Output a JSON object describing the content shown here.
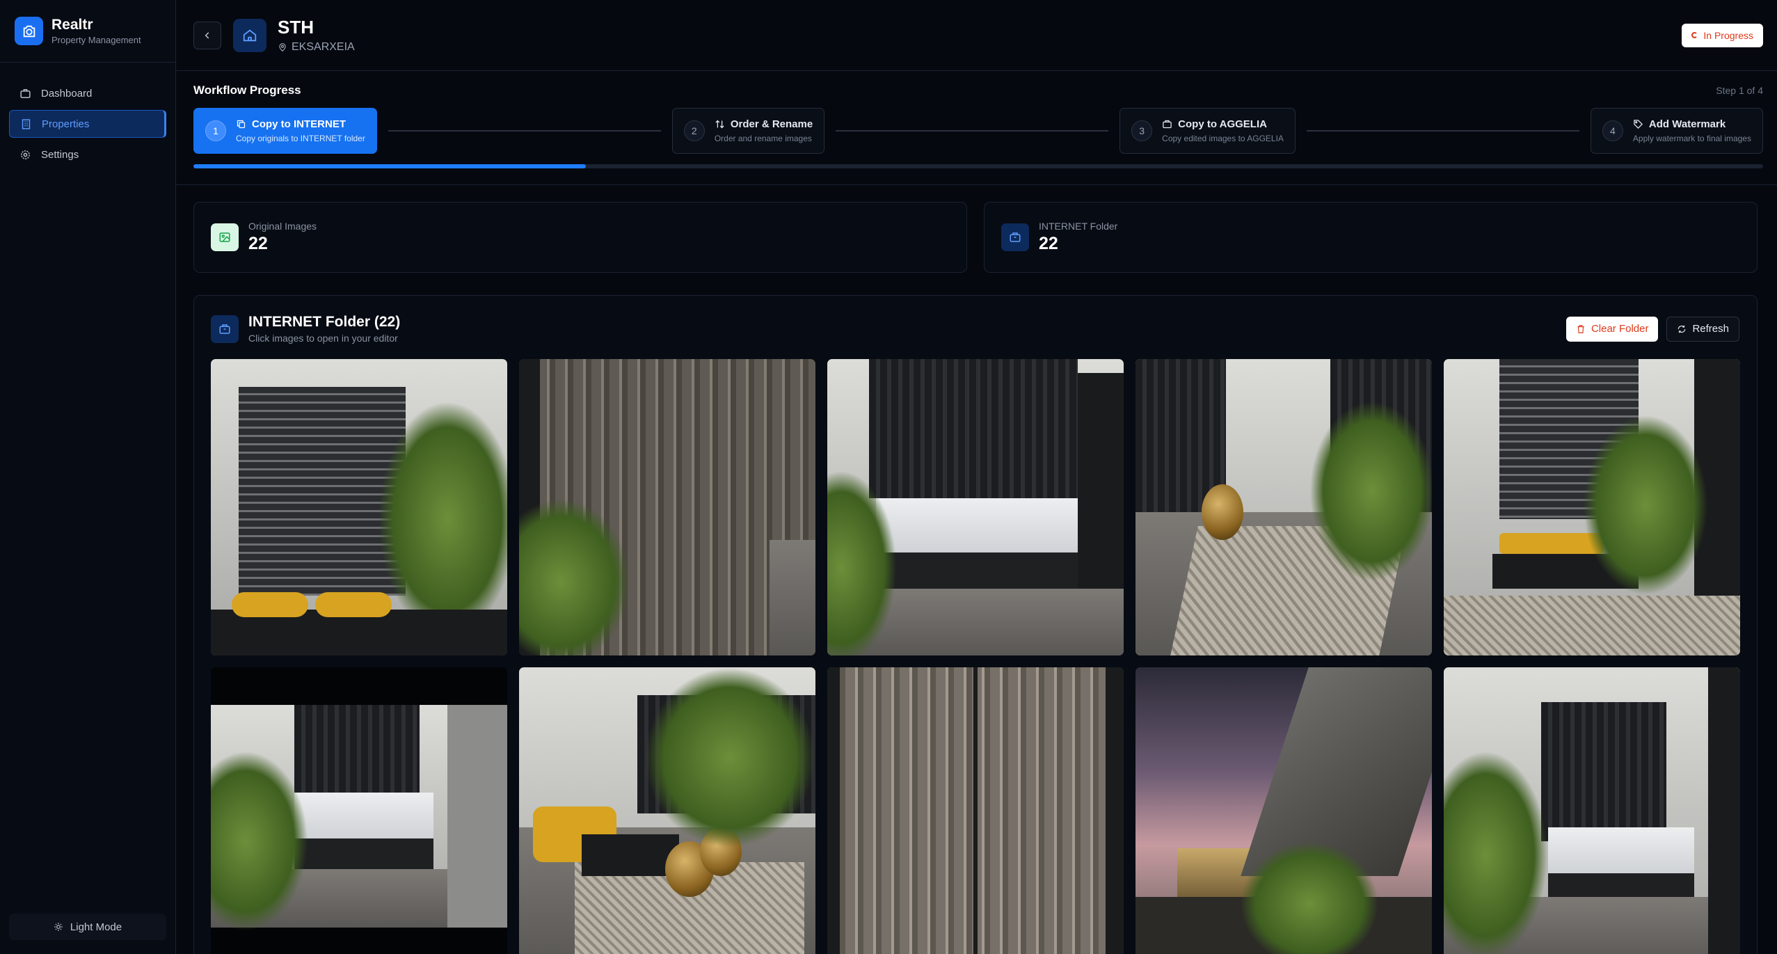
{
  "brand": {
    "name": "Realtr",
    "subtitle": "Property Management",
    "logo_icon": "camera-icon",
    "accent": "#1a6ff0"
  },
  "sidebar": {
    "items": [
      {
        "label": "Dashboard",
        "icon": "briefcase-icon",
        "active": false
      },
      {
        "label": "Properties",
        "icon": "building-icon",
        "active": true
      },
      {
        "label": "Settings",
        "icon": "gear-icon",
        "active": false
      }
    ],
    "light_mode_label": "Light Mode"
  },
  "header": {
    "title": "STH",
    "location": "EKSARXEIA",
    "status": "In Progress",
    "status_color": "#e0381b"
  },
  "workflow": {
    "title": "Workflow Progress",
    "step_indicator": "Step 1 of 4",
    "progress_fraction": 0.25,
    "steps": [
      {
        "num": "1",
        "label": "Copy to INTERNET",
        "desc": "Copy originals to INTERNET folder",
        "icon": "copy-icon",
        "active": true
      },
      {
        "num": "2",
        "label": "Order & Rename",
        "desc": "Order and rename images",
        "icon": "sort-arrows-icon",
        "active": false
      },
      {
        "num": "3",
        "label": "Copy to AGGELIA",
        "desc": "Copy edited images to AGGELIA",
        "icon": "folder-copy-icon",
        "active": false
      },
      {
        "num": "4",
        "label": "Add Watermark",
        "desc": "Apply watermark to final images",
        "icon": "tag-icon",
        "active": false
      }
    ]
  },
  "stats": [
    {
      "label": "Original Images",
      "value": "22",
      "icon": "image-icon"
    },
    {
      "label": "INTERNET Folder",
      "value": "22",
      "icon": "folder-icon"
    }
  ],
  "folder": {
    "title": "INTERNET Folder (22)",
    "subtitle": "Click images to open in your editor",
    "clear_label": "Clear Folder",
    "refresh_label": "Refresh",
    "images": [
      "window-plant-sofa-photo",
      "wooden-wardrobe-photo",
      "bedroom-headboard-photo",
      "living-room-rug-photo",
      "bench-window-plant-photo",
      "bedroom-doorway-photo",
      "yellow-sofa-lounge-photo",
      "wardrobe-doors-photo",
      "acropolis-balcony-sunset-photo",
      "bedroom-plant-photo"
    ]
  }
}
